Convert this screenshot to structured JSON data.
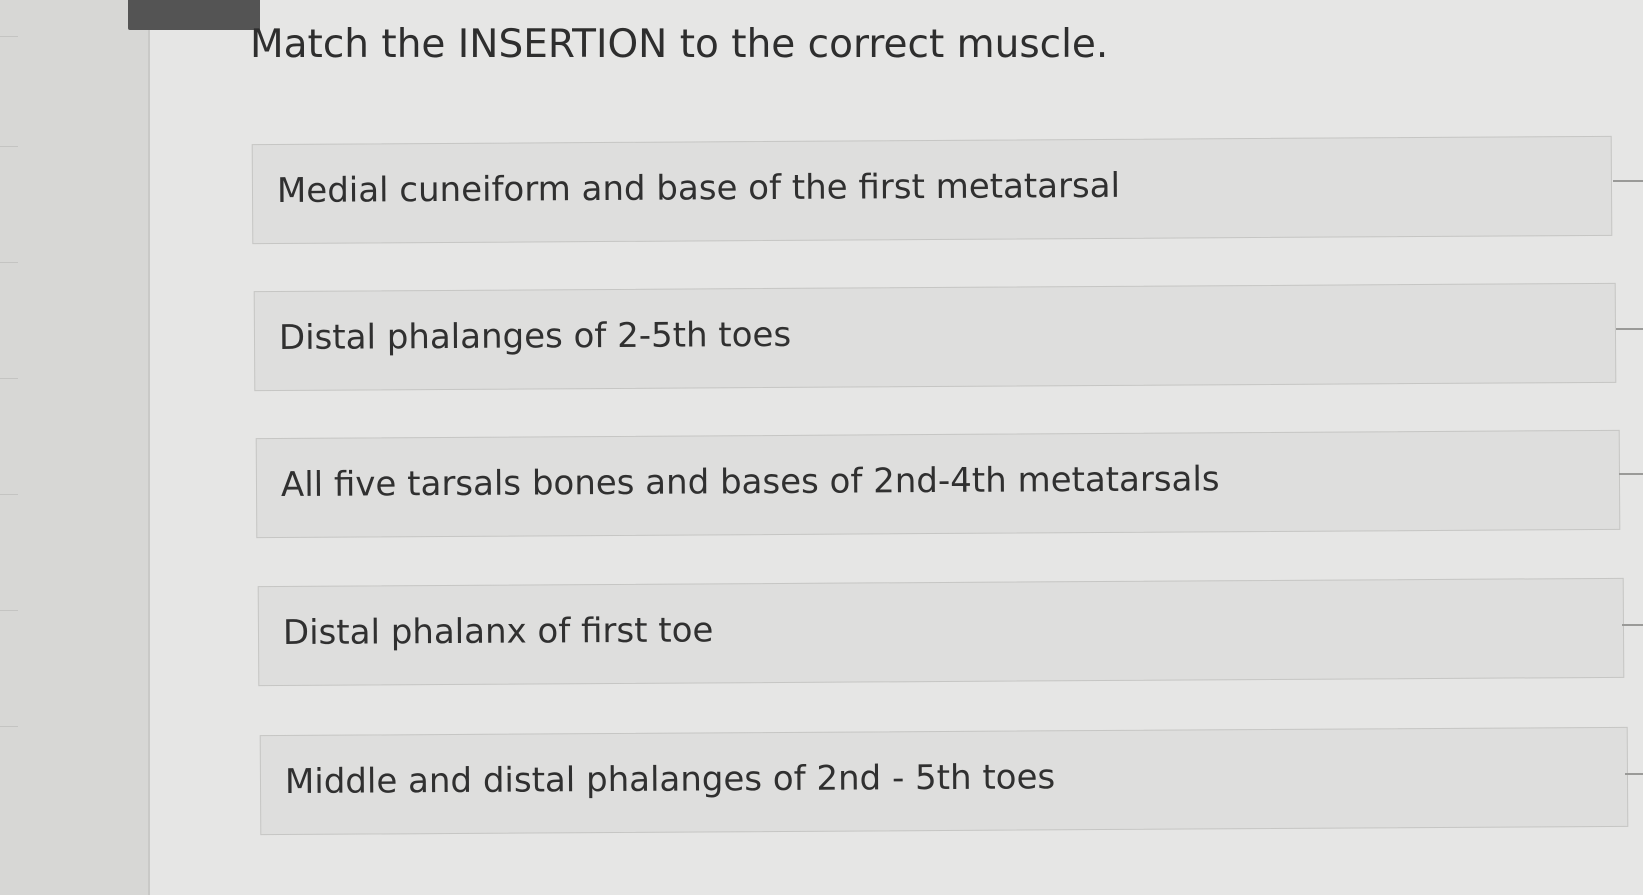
{
  "question": {
    "title": "Match the INSERTION to the correct muscle."
  },
  "answers": [
    {
      "label": "Medial cuneiform and base of the first metatarsal"
    },
    {
      "label": "Distal phalanges of 2-5th toes"
    },
    {
      "label": "All five tarsals bones and bases of 2nd-4th metatarsals"
    },
    {
      "label": "Distal phalanx of first toe"
    },
    {
      "label": "Middle and distal phalanges of 2nd - 5th toes"
    }
  ]
}
